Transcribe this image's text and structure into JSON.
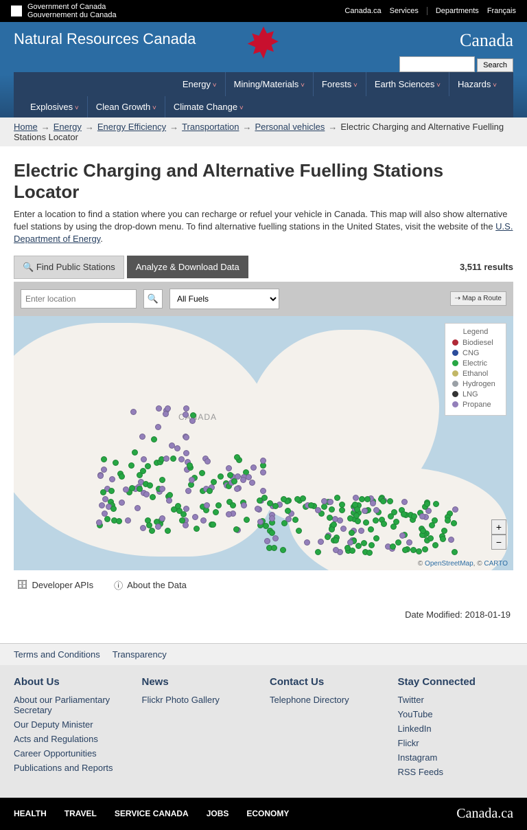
{
  "govbar": {
    "fip_en": "Government of Canada",
    "fip_fr": "Gouvernement du Canada",
    "links": [
      "Canada.ca",
      "Services",
      "Departments",
      "Français"
    ]
  },
  "banner": {
    "site_title": "Natural Resources Canada",
    "wordmark": "Canada",
    "search_btn": "Search"
  },
  "nav1": [
    "Energy",
    "Mining/Materials",
    "Forests",
    "Earth Sciences",
    "Hazards"
  ],
  "nav2": [
    "Explosives",
    "Clean Growth",
    "Climate Change"
  ],
  "breadcrumb": {
    "links": [
      "Home",
      "Energy",
      "Energy Efficiency",
      "Transportation",
      "Personal vehicles"
    ],
    "current": "Electric Charging and Alternative Fuelling Stations Locator"
  },
  "page": {
    "title": "Electric Charging and Alternative Fuelling Stations Locator",
    "intro_a": "Enter a location to find a station where you can recharge or refuel your vehicle in Canada. This map will also show alternative fuel stations by using the drop-down menu. To find alternative fuelling stations in the United States, visit the website of the ",
    "intro_link": "U.S. Department of Energy",
    "intro_b": ".",
    "tab_find": "Find Public Stations",
    "tab_analyze": "Analyze & Download Data",
    "results": "3,511 results",
    "loc_placeholder": "Enter location",
    "fuel_select": "All Fuels",
    "route_btn": "Map a Route",
    "map_label": "CANADA",
    "legend_title": "Legend",
    "legend": [
      {
        "label": "Biodiesel",
        "color": "#b02a37"
      },
      {
        "label": "CNG",
        "color": "#2b4c9b"
      },
      {
        "label": "Electric",
        "color": "#27a744"
      },
      {
        "label": "Ethanol",
        "color": "#c2b766"
      },
      {
        "label": "Hydrogen",
        "color": "#9aa0a6"
      },
      {
        "label": "LNG",
        "color": "#333333"
      },
      {
        "label": "Propane",
        "color": "#937fba"
      }
    ],
    "attrib_osm": "OpenStreetMap",
    "attrib_carto": "CARTO",
    "dev_api": "Developer APIs",
    "about_data": "About the Data",
    "date_modified": "Date Modified: 2018-01-19"
  },
  "subfooter": [
    "Terms and Conditions",
    "Transparency"
  ],
  "footer": {
    "cols": [
      {
        "h": "About Us",
        "items": [
          "About our Parliamentary Secretary",
          "Our Deputy Minister",
          "Acts and Regulations",
          "Career Opportunities",
          "Publications and Reports"
        ]
      },
      {
        "h": "News",
        "items": [
          "Flickr Photo Gallery"
        ]
      },
      {
        "h": "Contact Us",
        "items": [
          "Telephone Directory"
        ]
      },
      {
        "h": "Stay Connected",
        "items": [
          "Twitter",
          "YouTube",
          "LinkedIn",
          "Flickr",
          "Instagram",
          "RSS Feeds"
        ]
      }
    ]
  },
  "blackfooter": {
    "items": [
      "HEALTH",
      "TRAVEL",
      "SERVICE CANADA",
      "JOBS",
      "ECONOMY"
    ],
    "wordmark": "Canada.ca"
  }
}
